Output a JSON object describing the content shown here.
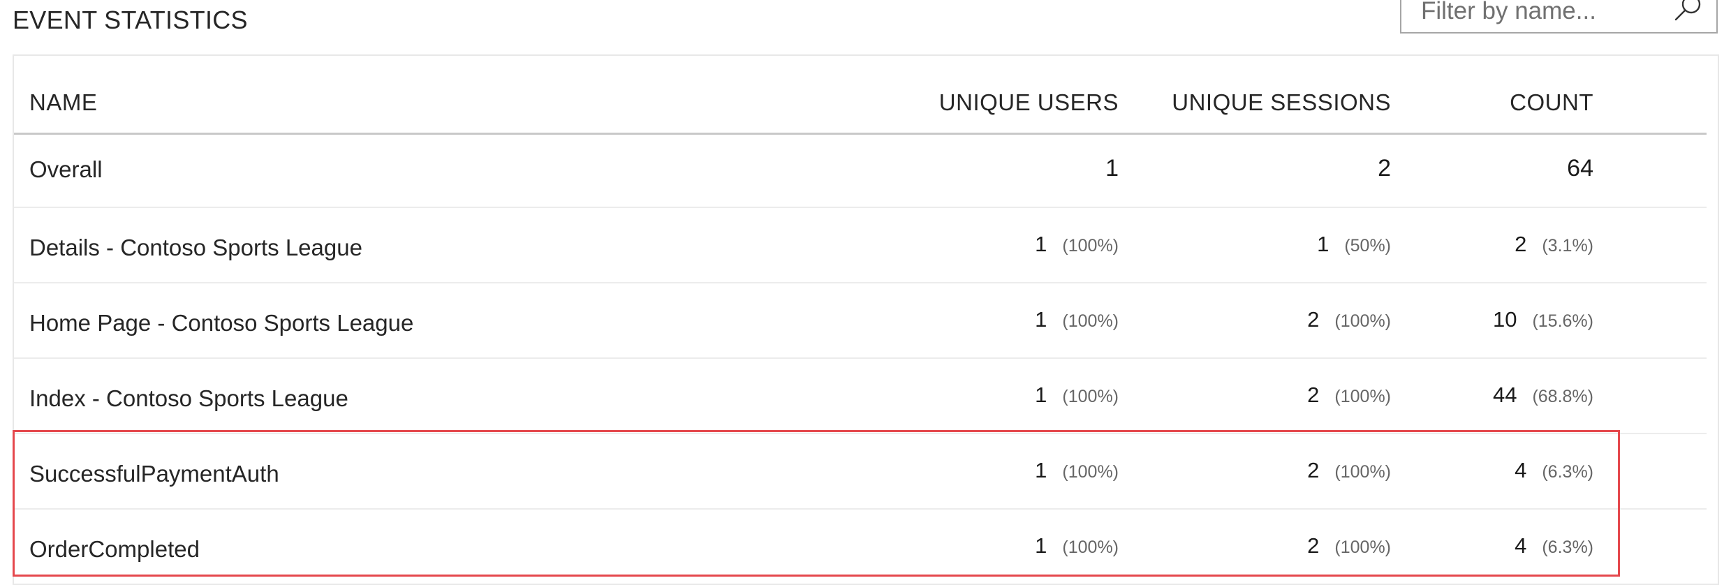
{
  "title": "EVENT STATISTICS",
  "filter": {
    "placeholder": "Filter by name..."
  },
  "icons": {
    "search": "search-icon"
  },
  "colors": {
    "highlight": "#e5484d"
  },
  "table": {
    "columns": {
      "name": "NAME",
      "unique_users": "UNIQUE USERS",
      "unique_sessions": "UNIQUE SESSIONS",
      "count": "COUNT"
    },
    "overall": {
      "name": "Overall",
      "users": "1",
      "sessions": "2",
      "count": "64"
    },
    "rows": [
      {
        "name": "Details - Contoso Sports League",
        "users": "1",
        "users_pct": "(100%)",
        "sessions": "1",
        "sessions_pct": "(50%)",
        "count": "2",
        "count_pct": "(3.1%)"
      },
      {
        "name": "Home Page - Contoso Sports League",
        "users": "1",
        "users_pct": "(100%)",
        "sessions": "2",
        "sessions_pct": "(100%)",
        "count": "10",
        "count_pct": "(15.6%)"
      },
      {
        "name": "Index - Contoso Sports League",
        "users": "1",
        "users_pct": "(100%)",
        "sessions": "2",
        "sessions_pct": "(100%)",
        "count": "44",
        "count_pct": "(68.8%)"
      },
      {
        "name": "SuccessfulPaymentAuth",
        "users": "1",
        "users_pct": "(100%)",
        "sessions": "2",
        "sessions_pct": "(100%)",
        "count": "4",
        "count_pct": "(6.3%)"
      },
      {
        "name": "OrderCompleted",
        "users": "1",
        "users_pct": "(100%)",
        "sessions": "2",
        "sessions_pct": "(100%)",
        "count": "4",
        "count_pct": "(6.3%)"
      }
    ]
  }
}
